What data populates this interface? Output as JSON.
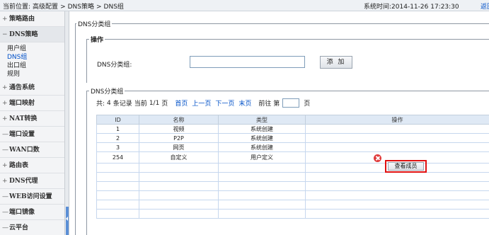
{
  "header": {
    "breadcrumb_prefix": "当前位置:",
    "breadcrumb": [
      "高级配置",
      "DNS策略",
      "DNS组"
    ],
    "separator": ">",
    "system_time_label": "系统时间:",
    "system_time": "2014-11-26 17:23:30",
    "back_link": "返回首"
  },
  "sidebar": {
    "items": [
      {
        "sign": "+",
        "label": "策略路由"
      },
      {
        "sign": "−",
        "label": "DNS策略",
        "open": true,
        "children": [
          "用户组",
          "DNS组",
          "出口组",
          "规则"
        ],
        "active_child": "DNS组"
      },
      {
        "sign": "+",
        "label": "通告系统"
      },
      {
        "sign": "+",
        "label": "端口映射"
      },
      {
        "sign": "+",
        "label": "NAT转换"
      },
      {
        "sign": "—",
        "label": "端口设置"
      },
      {
        "sign": "—",
        "label": "WAN口数"
      },
      {
        "sign": "+",
        "label": "路由表"
      },
      {
        "sign": "+",
        "label": "DNS代理"
      },
      {
        "sign": "—",
        "label": "WEB访问设置"
      },
      {
        "sign": "—",
        "label": "端口镜像"
      },
      {
        "sign": "—",
        "label": "云平台"
      }
    ]
  },
  "main": {
    "outer_legend": "DNS分类组",
    "operation_legend": "操作",
    "field_label": "DNS分类组:",
    "field_value": "",
    "add_button": "添 加",
    "list_legend": "DNS分类组",
    "pager": {
      "total_prefix": "共:",
      "total_count": "4",
      "total_suffix": "条记录",
      "current_label": "当前",
      "current_page": "1/1",
      "page_unit": "页",
      "first": "首页",
      "prev": "上一页",
      "next": "下一页",
      "last": "末页",
      "goto_prefix": "前往 第",
      "goto_suffix": "页",
      "goto_value": ""
    },
    "table": {
      "headers": [
        "ID",
        "名称",
        "类型",
        "操作"
      ],
      "rows": [
        {
          "id": "1",
          "name": "视频",
          "type": "系统创建",
          "action": ""
        },
        {
          "id": "2",
          "name": "P2P",
          "type": "系统创建",
          "action": ""
        },
        {
          "id": "3",
          "name": "网页",
          "type": "系统创建",
          "action": ""
        },
        {
          "id": "254",
          "name": "自定义",
          "type": "用户定义",
          "action": "查看成员"
        }
      ],
      "empty_rows": 6
    }
  },
  "colors": {
    "link": "#0050c8",
    "highlight": "#e01010",
    "delete": "#e03b3b",
    "table_header": "#dfe9f5"
  }
}
